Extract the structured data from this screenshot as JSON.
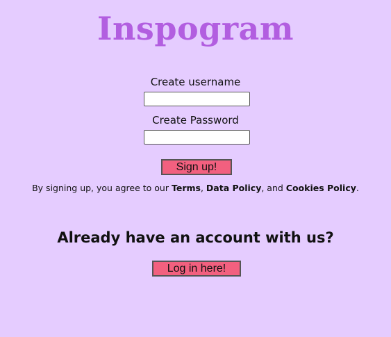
{
  "brand": {
    "name": "Inspogram",
    "color": "#b25ee0"
  },
  "signup": {
    "username_label": "Create username",
    "username_value": "",
    "password_label": "Create Password",
    "password_value": "",
    "submit_label": "Sign up!"
  },
  "terms": {
    "prefix": "By signing up, you agree to our ",
    "terms_link": "Terms",
    "sep1": ", ",
    "data_policy_link": "Data Policy",
    "sep2": ", and ",
    "cookies_link": "Cookies Policy",
    "suffix": "."
  },
  "login": {
    "heading": "Already have an account with us?",
    "button_label": "Log in here!"
  },
  "colors": {
    "background": "#e5ccff",
    "button": "#f2607f"
  }
}
